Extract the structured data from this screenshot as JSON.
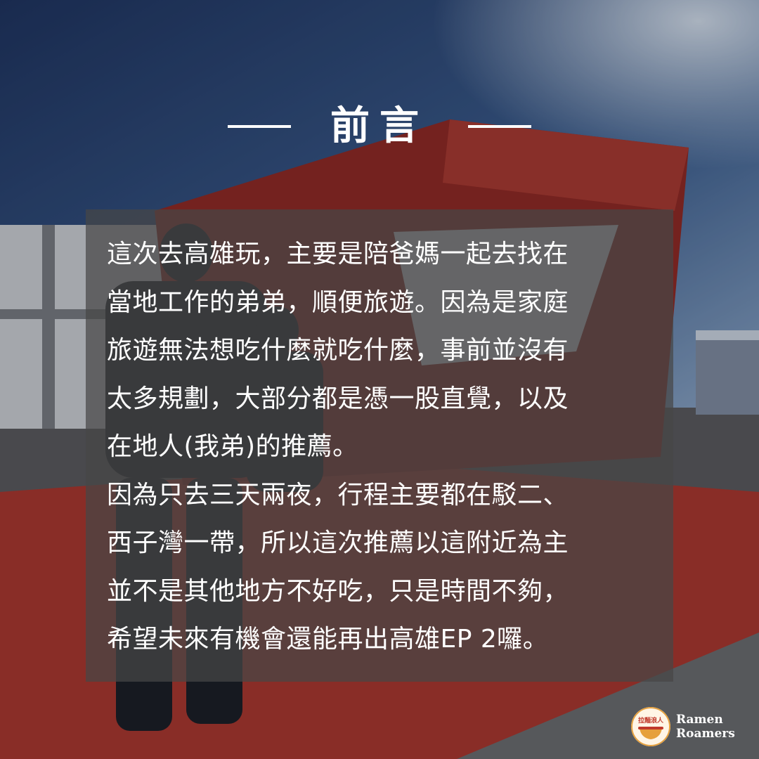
{
  "title": "前言",
  "body_lines": [
    "這次去高雄玩，主要是陪爸媽一起去找在",
    "當地工作的弟弟，順便旅遊。因為是家庭",
    "旅遊無法想吃什麼就吃什麼，事前並沒有",
    "太多規劃，大部分都是憑一股直覺，以及",
    "在地人(我弟)的推薦。",
    "因為只去三天兩夜，行程主要都在駁二、",
    "西子灣一帶，所以這次推薦以這附近為主",
    "並不是其他地方不好吃，只是時間不夠，",
    "希望未來有機會還能再出高雄EP 2囉。"
  ],
  "logo": {
    "badge_text": "拉麵浪人",
    "name_line1": "Ramen",
    "name_line2": "Roamers"
  },
  "colors": {
    "sky": "#2c4a7a",
    "container_red": "#8e2a26",
    "ground_red": "#a83830",
    "panel": "#464646",
    "text": "#ffffff"
  }
}
